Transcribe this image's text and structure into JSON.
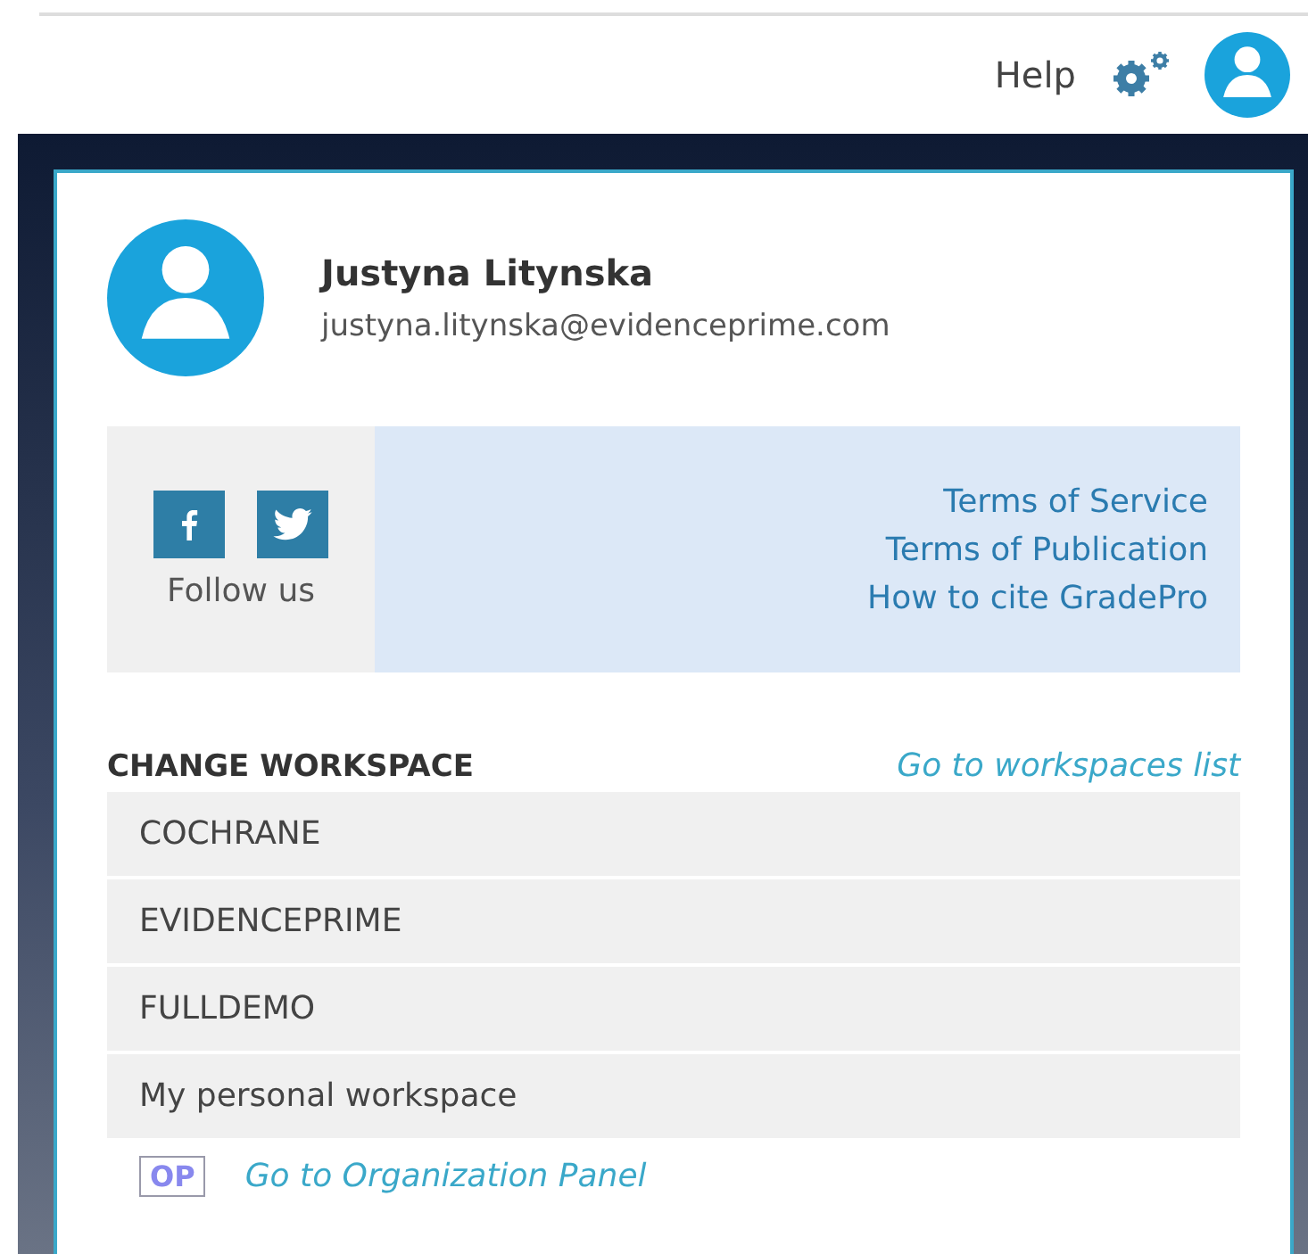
{
  "header": {
    "help": "Help"
  },
  "user": {
    "name": "Justyna Litynska",
    "email": "justyna.litynska@evidenceprime.com"
  },
  "social": {
    "label": "Follow us"
  },
  "links": [
    "Terms of Service",
    "Terms of Publication",
    "How to cite GradePro"
  ],
  "workspaces": {
    "heading": "CHANGE WORKSPACE",
    "list_link": "Go to workspaces list",
    "items": [
      "COCHRANE",
      "EVIDENCEPRIME",
      "FULLDEMO",
      "My personal workspace"
    ]
  },
  "organization": {
    "badge": "OP",
    "link": "Go to Organization Panel"
  }
}
